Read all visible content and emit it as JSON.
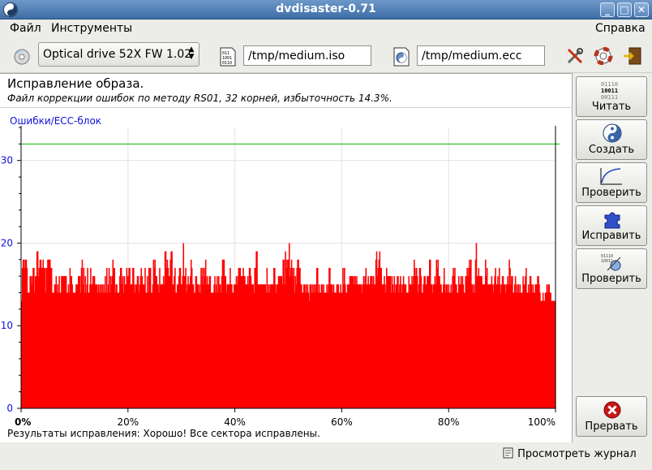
{
  "window": {
    "title": "dvdisaster-0.71"
  },
  "menu": {
    "file": "Файл",
    "tools": "Инструменты",
    "help": "Справка"
  },
  "toolbar": {
    "drive": "Optical drive 52X FW 1.02",
    "image_path": "/tmp/medium.iso",
    "ecc_path": "/tmp/medium.ecc"
  },
  "main": {
    "heading": "Исправление образа.",
    "subheading": "Файл коррекции ошибок по методу RS01, 32 корней, избыточность 14.3%.",
    "result": "Результаты исправления: Хорошо! Все сектора исправлены."
  },
  "sidebar": {
    "read": "Читать",
    "create": "Создать",
    "verify": "Проверить",
    "repair": "Исправить",
    "compare": "Проверить",
    "stop": "Прервать"
  },
  "status": {
    "view_log": "Просмотреть журнал"
  },
  "chart_data": {
    "type": "bar",
    "ylabel": "Ошибки/ЕСС-блок",
    "ylim": [
      0,
      34
    ],
    "yticks": [
      0,
      10,
      20,
      30
    ],
    "xticks": [
      "0%",
      "20%",
      "40%",
      "60%",
      "80%",
      "100%"
    ],
    "xlim": [
      0,
      100
    ],
    "threshold": 32,
    "bar_color": "#ff0000",
    "threshold_color": "#00bb00",
    "axis_label_color": "#1111dd",
    "values": [
      13,
      17,
      18,
      18,
      17,
      18,
      18,
      17,
      14,
      14,
      14,
      16,
      16,
      15,
      16,
      17,
      17,
      14,
      16,
      16,
      19,
      19,
      16,
      17,
      18,
      18,
      17,
      17,
      18,
      17,
      17,
      14,
      17,
      17,
      18,
      18,
      18,
      18,
      17,
      17,
      14,
      14,
      14,
      15,
      15,
      16,
      14,
      15,
      14,
      16,
      14,
      14,
      16,
      16,
      16,
      16,
      16,
      16,
      16,
      14,
      14,
      15,
      14,
      17,
      16,
      16,
      15,
      14,
      14,
      14,
      14,
      15,
      15,
      15,
      16,
      16,
      16,
      14,
      17,
      18,
      15,
      17,
      14,
      16,
      14,
      15,
      17,
      14,
      14,
      15,
      17,
      15,
      15,
      16,
      16,
      16,
      15,
      15,
      15,
      14,
      15,
      14,
      15,
      14,
      15,
      15,
      14,
      15,
      14,
      16,
      14,
      17,
      14,
      15,
      17,
      14,
      16,
      15,
      16,
      18,
      17,
      17,
      14,
      15,
      15,
      14,
      14,
      14,
      16,
      17,
      17,
      15,
      16,
      14,
      16,
      15,
      15,
      17,
      16,
      16,
      17,
      17,
      15,
      15,
      15,
      17,
      17,
      15,
      14,
      15,
      15,
      16,
      16,
      14,
      15,
      16,
      17,
      16,
      15,
      15,
      15,
      17,
      14,
      14,
      16,
      14,
      17,
      17,
      17,
      14,
      14,
      15,
      18,
      17,
      18,
      16,
      16,
      15,
      15,
      14,
      17,
      15,
      15,
      15,
      15,
      16,
      15,
      19,
      19,
      17,
      18,
      17,
      16,
      16,
      18,
      19,
      19,
      15,
      15,
      16,
      17,
      14,
      14,
      15,
      15,
      16,
      17,
      17,
      15,
      15,
      16,
      20,
      16,
      16,
      17,
      14,
      15,
      16,
      15,
      15,
      16,
      18,
      17,
      15,
      15,
      14,
      14,
      16,
      16,
      15,
      15,
      14,
      15,
      14,
      17,
      16,
      17,
      15,
      17,
      16,
      18,
      15,
      16,
      15,
      15,
      16,
      16,
      14,
      14,
      14,
      14,
      15,
      16,
      14,
      15,
      16,
      14,
      16,
      15,
      15,
      14,
      16,
      18,
      18,
      18,
      16,
      16,
      14,
      15,
      15,
      15,
      15,
      17,
      15,
      15,
      14,
      14,
      15,
      15,
      15,
      16,
      15,
      16,
      17,
      17,
      17,
      16,
      16,
      16,
      17,
      16,
      16,
      15,
      15,
      15,
      16,
      15,
      17,
      17,
      16,
      15,
      15,
      15,
      14,
      17,
      17,
      19,
      19,
      15,
      15,
      15,
      15,
      15,
      15,
      15,
      15,
      15,
      15,
      15,
      14,
      17,
      14,
      15,
      14,
      15,
      15,
      15,
      15,
      15,
      17,
      17,
      15,
      14,
      15,
      15,
      16,
      16,
      16,
      16,
      16,
      15,
      18,
      18,
      15,
      19,
      18,
      17,
      18,
      18,
      20,
      16,
      17,
      18,
      17,
      16,
      17,
      14,
      16,
      15,
      17,
      18,
      18,
      17,
      17,
      15,
      15,
      14,
      14,
      15,
      15,
      14,
      15,
      14,
      15,
      14,
      13,
      15,
      15,
      14,
      15,
      14,
      15,
      15,
      14,
      15,
      17,
      17,
      14,
      15,
      14,
      14,
      15,
      15,
      14,
      15,
      14,
      14,
      14,
      15,
      14,
      15,
      17,
      17,
      15,
      15,
      15,
      14,
      15,
      14,
      14,
      14,
      15,
      15,
      15,
      14,
      14,
      15,
      14,
      14,
      17,
      15,
      17,
      15,
      14,
      14,
      15,
      15,
      15,
      16,
      16,
      16,
      16,
      16,
      15,
      16,
      16,
      15,
      16,
      15,
      15,
      15,
      15,
      15,
      15,
      14,
      15,
      16,
      15,
      16,
      17,
      15,
      15,
      16,
      15,
      15,
      16,
      16,
      16,
      15,
      16,
      15,
      15,
      18,
      19,
      16,
      17,
      18,
      19,
      17,
      17,
      15,
      15,
      15,
      16,
      15,
      14,
      17,
      16,
      16,
      16,
      16,
      16,
      14,
      16,
      15,
      14,
      16,
      14,
      15,
      15,
      16,
      16,
      14,
      15,
      16,
      15,
      14,
      15,
      16,
      15,
      15,
      15,
      14,
      14,
      14,
      16,
      15,
      15,
      15,
      16,
      15,
      16,
      18,
      17,
      16,
      17,
      16,
      14,
      15,
      17,
      17,
      16,
      14,
      14,
      15,
      16,
      16,
      15,
      15,
      16,
      16,
      16,
      18,
      18,
      15,
      15,
      14,
      15,
      15,
      16,
      15,
      18,
      17,
      18,
      16,
      16,
      15,
      15,
      14,
      14,
      15,
      17,
      15,
      14,
      15,
      15,
      14,
      15,
      14,
      14,
      15,
      14,
      16,
      17,
      16,
      17,
      15,
      15,
      14,
      14,
      16,
      15,
      15,
      16,
      15,
      16,
      15,
      14,
      14,
      16,
      16,
      17,
      16,
      17,
      18,
      17,
      18,
      15,
      15,
      14,
      15,
      14,
      18,
      20,
      16,
      16,
      17,
      16,
      16,
      16,
      16,
      15,
      15,
      15,
      15,
      18,
      16,
      17,
      15,
      15,
      15,
      15,
      15,
      16,
      15,
      14,
      15,
      16,
      17,
      15,
      15,
      16,
      15,
      17,
      15,
      14,
      15,
      16,
      16,
      15,
      15,
      14,
      15,
      15,
      16,
      15,
      18,
      17,
      15,
      16,
      16,
      14,
      14,
      15,
      16,
      14,
      15,
      14,
      15,
      14,
      15,
      14,
      14,
      14,
      16,
      15,
      15,
      16,
      17,
      14,
      14,
      15,
      14,
      16,
      16,
      15,
      14,
      15,
      14,
      14,
      15,
      15,
      15,
      16,
      16,
      15,
      14,
      13,
      13,
      13,
      14,
      13,
      13,
      14,
      14,
      15,
      14,
      15,
      15,
      14,
      14,
      13,
      13,
      13,
      13,
      13,
      13
    ]
  }
}
